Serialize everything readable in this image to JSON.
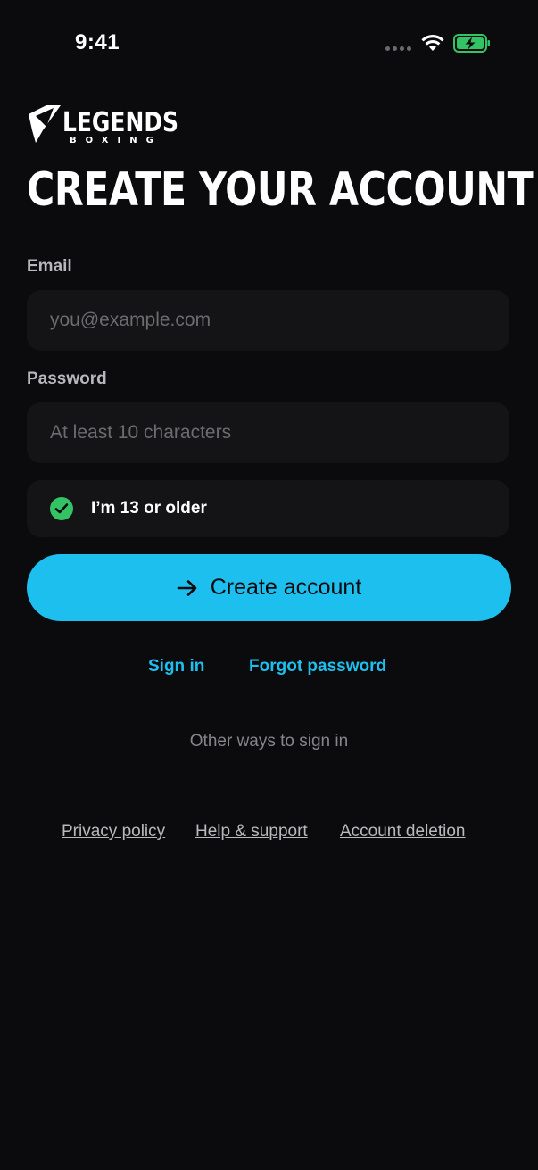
{
  "status_bar": {
    "time": "9:41"
  },
  "brand": {
    "logo_text": "LEGENDS",
    "logo_subtext": "BOXING",
    "accent_color": "#1dbfee",
    "check_color": "#34c364",
    "battery_color": "#34c364"
  },
  "headline": "CREATE YOUR ACCOUNT",
  "form": {
    "email": {
      "label": "Email",
      "value": "",
      "placeholder": "you@example.com"
    },
    "password": {
      "label": "Password",
      "value": "",
      "placeholder": "At least 10 characters"
    },
    "age_check": {
      "label": "I’m 13 or older",
      "checked": true,
      "icon": "check-icon"
    },
    "submit": {
      "label": "Create account",
      "icon": "arrow-right-icon"
    }
  },
  "links": {
    "sign_in": "Sign in",
    "forgot_password": "Forgot password",
    "other_ways": "Other ways to sign in"
  },
  "footer": {
    "privacy": "Privacy policy",
    "help": "Help & support",
    "deletion": "Account deletion"
  }
}
